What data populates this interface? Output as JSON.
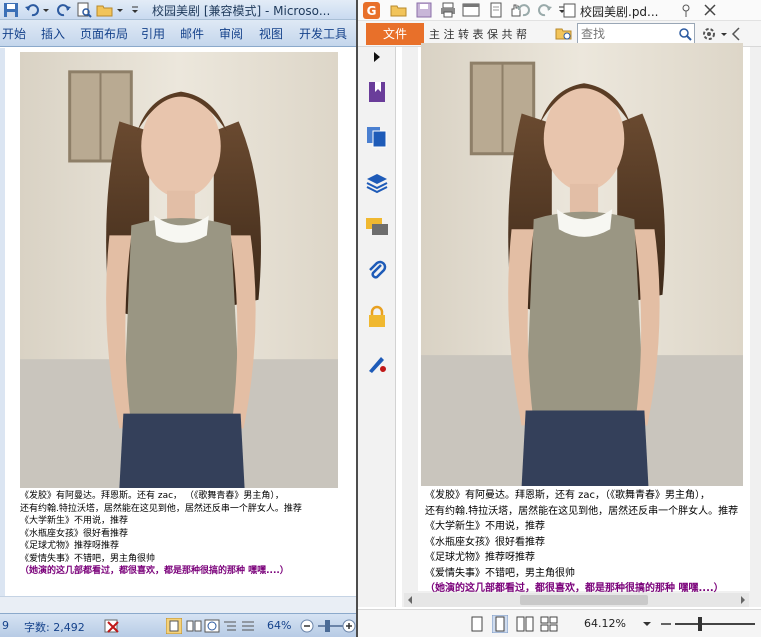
{
  "word": {
    "title": "校园美剧 [兼容模式] - Microso...",
    "tabs": [
      "开始",
      "插入",
      "页面布局",
      "引用",
      "邮件",
      "审阅",
      "视图",
      "开发工具"
    ],
    "doc_lines": [
      "《发胶》有阿曼达。拜恩斯。还有 zac， （《歌舞青春》男主角），",
      "还有约翰.特拉沃塔，居然能在这见到他，居然还反串一个胖女人。推荐",
      "《大学新生》不用说，推荐",
      "《水瓶座女孩》很好看推荐",
      "《足球尤物》推荐呀推荐",
      "《爱情失事》不错吧，男主角很帅"
    ],
    "doc_highlight": "（她演的这几部都看过，都很喜欢，都是那种很搞的那种 嘿嘿....）",
    "status_page": "9",
    "status_wordcount": "字数: 2,492",
    "status_zoom": "64%"
  },
  "pdf": {
    "title": "校园美剧.pd...",
    "file_tab": "文件",
    "menu_glyphs": "主 注 转 表 保 共 帮",
    "search_placeholder": "查找",
    "doc_lines": [
      "《发胶》有阿曼达。拜恩斯，还有 zac，（《歌舞青春》男主角），",
      "还有约翰.特拉沃塔，居然能在这见到他，居然还反串一个胖女人。推荐",
      "《大学新生》不用说，推荐",
      "《水瓶座女孩》很好看推荐",
      "《足球尤物》推荐呀推荐",
      "《爱情失事》不错吧，男主角很帅"
    ],
    "doc_highlight": "（她演的这几部都看过，都很喜欢，都是那种很搞的那种 嘿嘿....）",
    "zoom": "64.12%"
  },
  "colors": {
    "word_blue": "#15428b",
    "pdf_orange": "#e8702a",
    "highlight_purple": "#7a007a"
  }
}
